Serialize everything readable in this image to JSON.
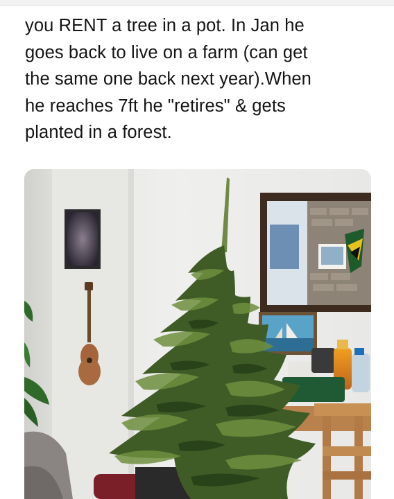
{
  "tweet": {
    "text_lines": [
      "you RENT a tree in a pot. In Jan he",
      "goes back to live on a farm (can get",
      "the same one back next year).When",
      "he reaches 7ft he \"retires\" & gets",
      "planted in a forest."
    ]
  },
  "photo": {
    "subject": "potted christmas tree in a living room",
    "colors": {
      "wall": "#eeeeec",
      "wall_shadow": "#d9d9d6",
      "tree_dark": "#2f4a1e",
      "tree_mid": "#4f6f2f",
      "tree_light": "#7c9a4a",
      "mirror_frame": "#3c2a1e",
      "wood": "#b07a45"
    }
  }
}
